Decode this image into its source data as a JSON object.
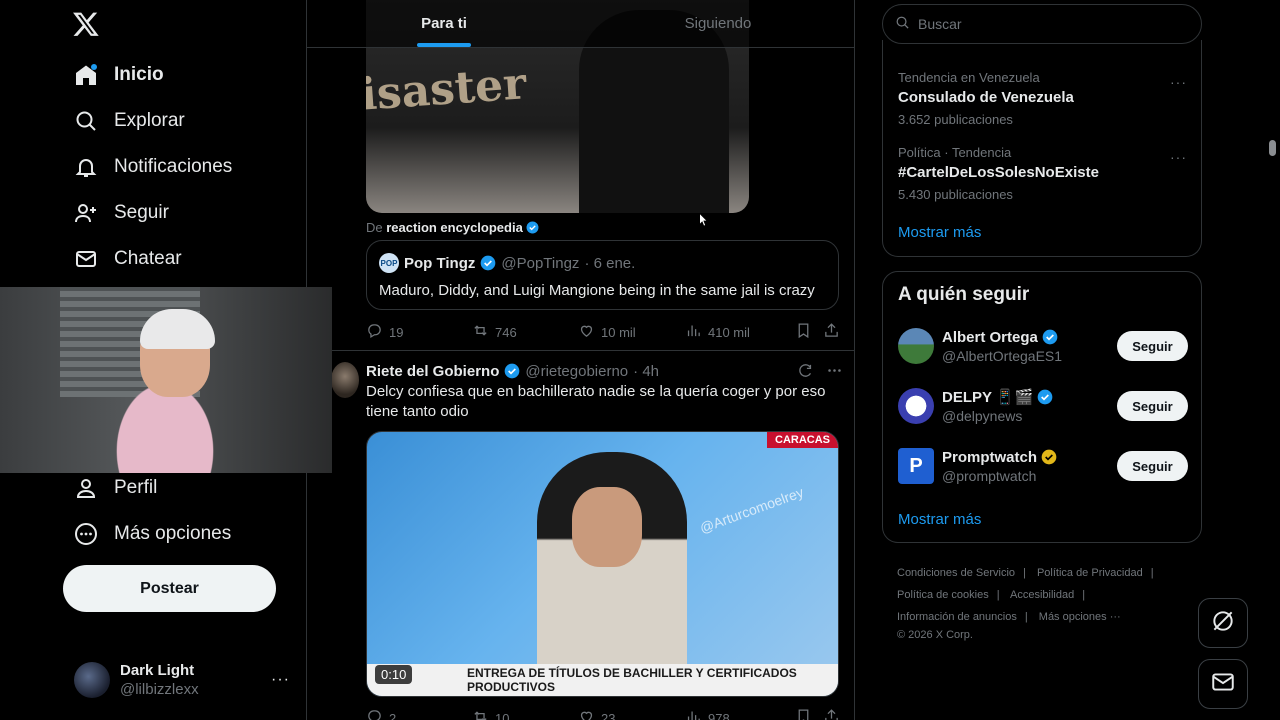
{
  "nav": {
    "items": [
      {
        "label": "Inicio",
        "icon": "home-icon"
      },
      {
        "label": "Explorar",
        "icon": "search-icon"
      },
      {
        "label": "Notificaciones",
        "icon": "bell-icon"
      },
      {
        "label": "Seguir",
        "icon": "add-person-icon"
      },
      {
        "label": "Chatear",
        "icon": "mail-icon"
      },
      {
        "label": "Perfil",
        "icon": "person-icon"
      },
      {
        "label": "Más opciones",
        "icon": "more-circle-icon"
      }
    ],
    "post_label": "Postear"
  },
  "account": {
    "display_name": "Dark Light",
    "handle": "@lilbizzlexx",
    "more": "···"
  },
  "tabs": [
    {
      "label": "Para ti"
    },
    {
      "label": "Siguiendo"
    }
  ],
  "tweet1": {
    "media_text": "isaster",
    "source_prefix": "De",
    "source_name": "reaction encyclopedia",
    "quote": {
      "avatar_text": "POP",
      "name": "Pop Tingz",
      "handle": "@PopTingz",
      "date": "· 6 ene.",
      "text": "Maduro, Diddy, and Luigi Mangione being in the same jail is crazy"
    },
    "stats": {
      "replies": "19",
      "reposts": "746",
      "likes": "10 mil",
      "views": "410 mil"
    }
  },
  "tweet2": {
    "name": "Riete del Gobierno",
    "handle": "@rietegobierno",
    "time": "· 4h",
    "text": "Delcy confiesa que en bachillerato nadie se la quería coger y por eso tiene tanto odio",
    "video": {
      "banner": "ENTREGA DE TÍTULOS DE BACHILLER Y CERTIFICADOS PRODUCTIVOS",
      "channel": "CARACAS",
      "watermark": "@Arturcomoelrey",
      "duration": "0:10"
    },
    "stats": {
      "replies": "2",
      "reposts": "10",
      "likes": "23",
      "views": "978"
    }
  },
  "search": {
    "placeholder": "Buscar"
  },
  "trends": [
    {
      "meta": "Tendencia en Venezuela",
      "name": "Consulado de Venezuela",
      "count": "3.652 publicaciones"
    },
    {
      "meta": "Política · Tendencia",
      "name": "#CartelDeLosSolesNoExiste",
      "count": "5.430 publicaciones"
    }
  ],
  "trends_show_more": "Mostrar más",
  "who_to_follow": {
    "title": "A quién seguir",
    "users": [
      {
        "name": "Albert Ortega",
        "handle": "@AlbertOrtegaES1",
        "badge": "blue",
        "button": "Seguir"
      },
      {
        "name": "DELPY 📱🎬",
        "handle": "@delpynews",
        "badge": "blue",
        "button": "Seguir"
      },
      {
        "name": "Promptwatch",
        "handle": "@promptwatch",
        "badge": "gold",
        "button": "Seguir"
      }
    ],
    "show_more": "Mostrar más"
  },
  "footer": {
    "links": [
      "Condiciones de Servicio",
      "Política de Privacidad",
      "Política de cookies",
      "Accesibilidad",
      "Información de anuncios",
      "Más opciones ···"
    ],
    "copyright": "© 2026 X Corp."
  },
  "colors": {
    "accent": "#1d9bf0",
    "background": "#000000",
    "text": "#e7e9ea",
    "muted": "#71767b",
    "border": "#2f3336"
  }
}
